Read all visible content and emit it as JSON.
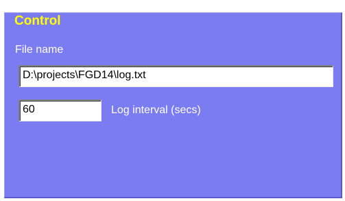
{
  "control": {
    "title": "Control",
    "file_name_label": "File name",
    "file_name_value": "D:\\projects\\FGD14\\log.txt",
    "interval_value": "60",
    "interval_label": "Log interval (secs)"
  },
  "colors": {
    "panel_background": "#7b7bf2",
    "title_text": "#ffff00",
    "label_text": "#ffffff"
  }
}
